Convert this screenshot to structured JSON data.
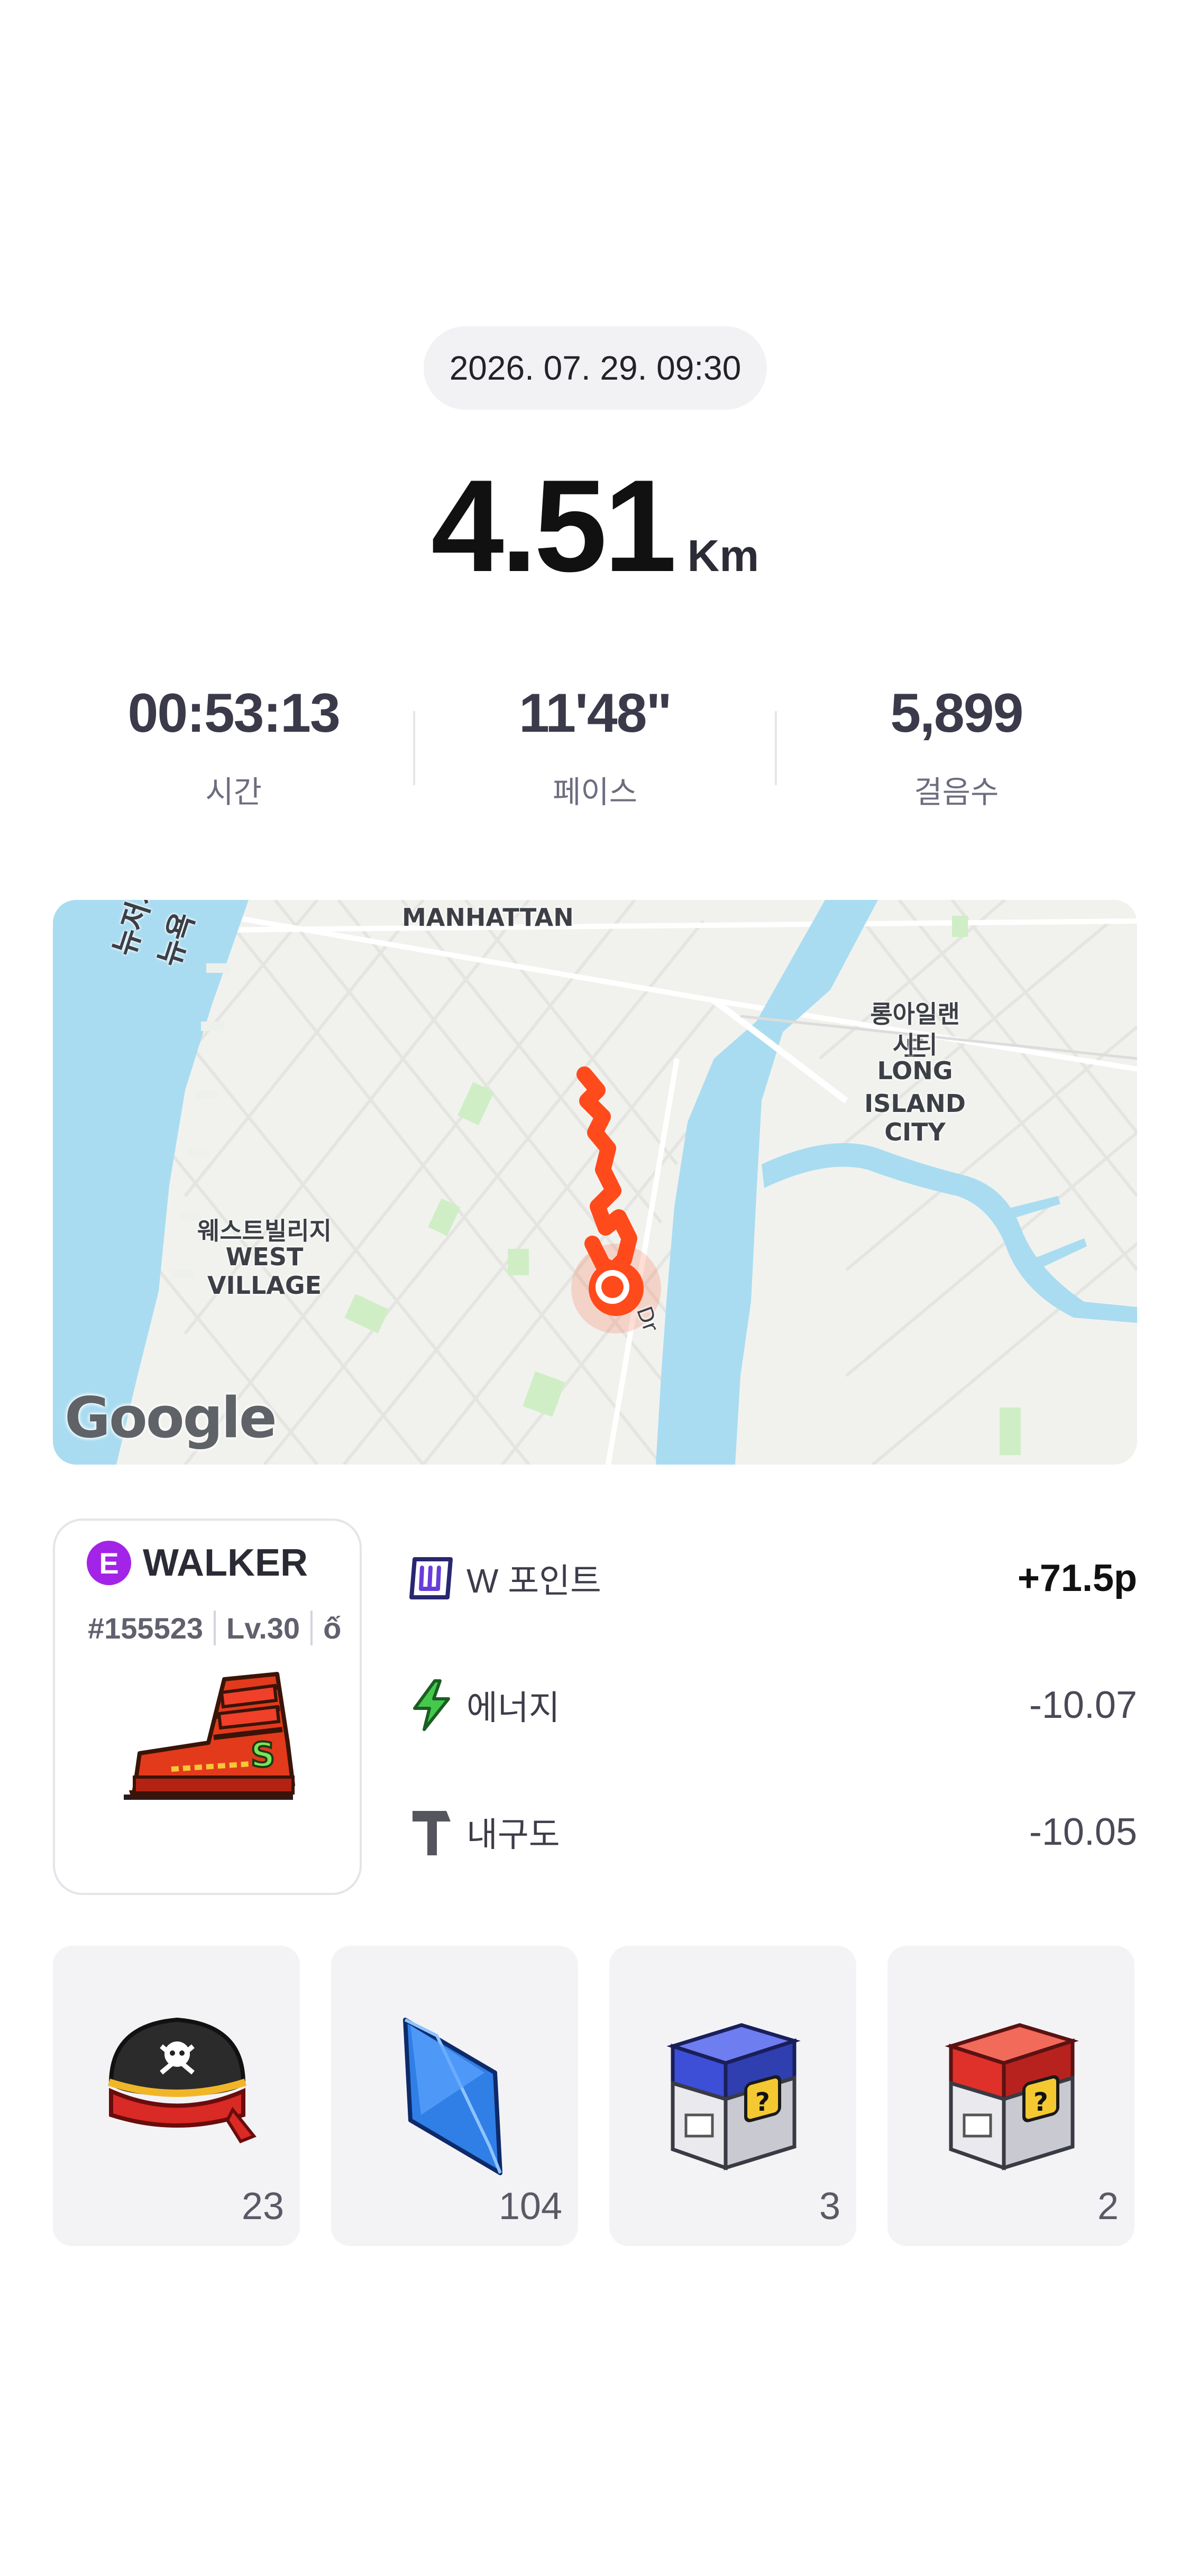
{
  "header": {
    "datetime": "2026. 07. 29. 09:30",
    "distance_value": "4.51",
    "distance_unit": "Km"
  },
  "stats": [
    {
      "value": "00:53:13",
      "label": "시간"
    },
    {
      "value": "11'48\"",
      "label": "페이스"
    },
    {
      "value": "5,899",
      "label": "걸음수"
    }
  ],
  "map": {
    "labels": {
      "manhattan": "MANHATTAN",
      "newjersey_ko": "뉴저지",
      "newyork_ko": "뉴욕",
      "lic_ko_1": "롱아일랜드",
      "lic_ko_2": "시티",
      "lic_en_1": "LONG",
      "lic_en_2": "ISLAND CITY",
      "wv_ko": "웨스트빌리지",
      "wv_en": "WEST VILLAGE",
      "road": "Dr",
      "google": "Google"
    },
    "colors": {
      "water": "#a9dcf1",
      "land": "#f1f2ee",
      "park": "#cfeec5",
      "route": "#ff4a1c"
    }
  },
  "nft": {
    "badge": "E",
    "name": "WALKER",
    "id": "#155523",
    "level": "Lv.30",
    "extra": "ố"
  },
  "rewards": [
    {
      "label": "W 포인트",
      "value": "+71.5p",
      "icon": "w-point-icon"
    },
    {
      "label": "에너지",
      "value": "-10.07",
      "icon": "lightning-icon"
    },
    {
      "label": "내구도",
      "value": "-10.05",
      "icon": "hammer-icon"
    }
  ],
  "items": [
    {
      "name": "pirate-hat",
      "count": "23"
    },
    {
      "name": "blue-gem",
      "count": "104"
    },
    {
      "name": "blue-mystery-box",
      "count": "3"
    },
    {
      "name": "red-mystery-box",
      "count": "2"
    }
  ]
}
